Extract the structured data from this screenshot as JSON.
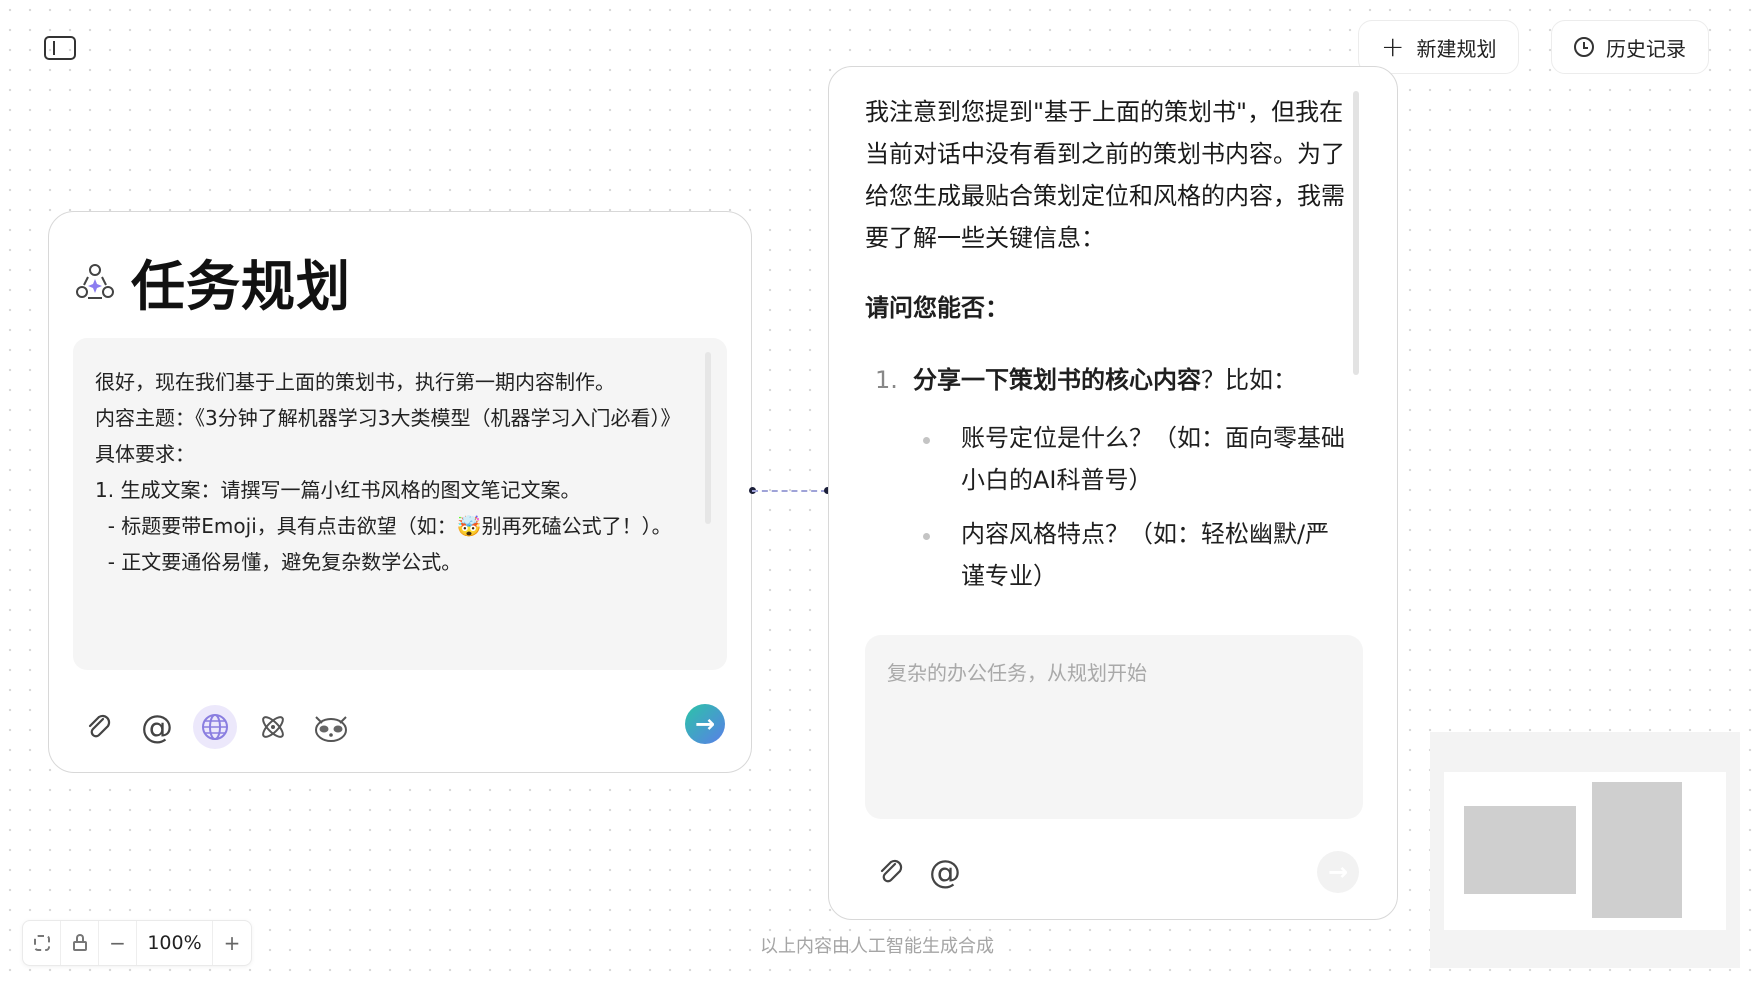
{
  "header": {
    "new_plan_label": "新建规划",
    "history_label": "历史记录"
  },
  "task_card": {
    "title": "任务规划",
    "prompt_text": "很好，现在我们基于上面的策划书，执行第一期内容制作。\n内容主题：《3分钟了解机器学习3大类模型（机器学习入门必看）》\n具体要求：\n1. 生成文案：请撰写一篇小红书风格的图文笔记文案。\n  - 标题要带Emoji，具有点击欲望（如：🤯别再死磕公式了！）。\n  - 正文要通俗易懂，避免复杂数学公式。",
    "tools": [
      "paperclip-icon",
      "at-icon",
      "globe-icon",
      "atom-icon",
      "raccoon-icon"
    ],
    "active_tool": "globe-icon"
  },
  "response_card": {
    "intro": "我注意到您提到\"基于上面的策划书\"，但我在当前对话中没有看到之前的策划书内容。为了给您生成最贴合策划定位和风格的内容，我需要了解一些关键信息：",
    "question_heading": "请问您能否：",
    "item1_number": "1.",
    "item1_bold": "分享一下策划书的核心内容",
    "item1_rest": "？比如：",
    "bullets": [
      "账号定位是什么？（如：面向零基础小白的AI科普号）",
      "内容风格特点？（如：轻松幽默/严谨专业）"
    ],
    "input_placeholder": "复杂的办公任务，从规划开始"
  },
  "zoom": {
    "level": "100%",
    "minus": "−",
    "plus": "+"
  },
  "footer_note": "以上内容由人工智能生成合成",
  "colors": {
    "accent_gradient_start": "#2bc4a7",
    "accent_gradient_end": "#5a7ee8",
    "active_tool_bg": "#ece8fb"
  }
}
